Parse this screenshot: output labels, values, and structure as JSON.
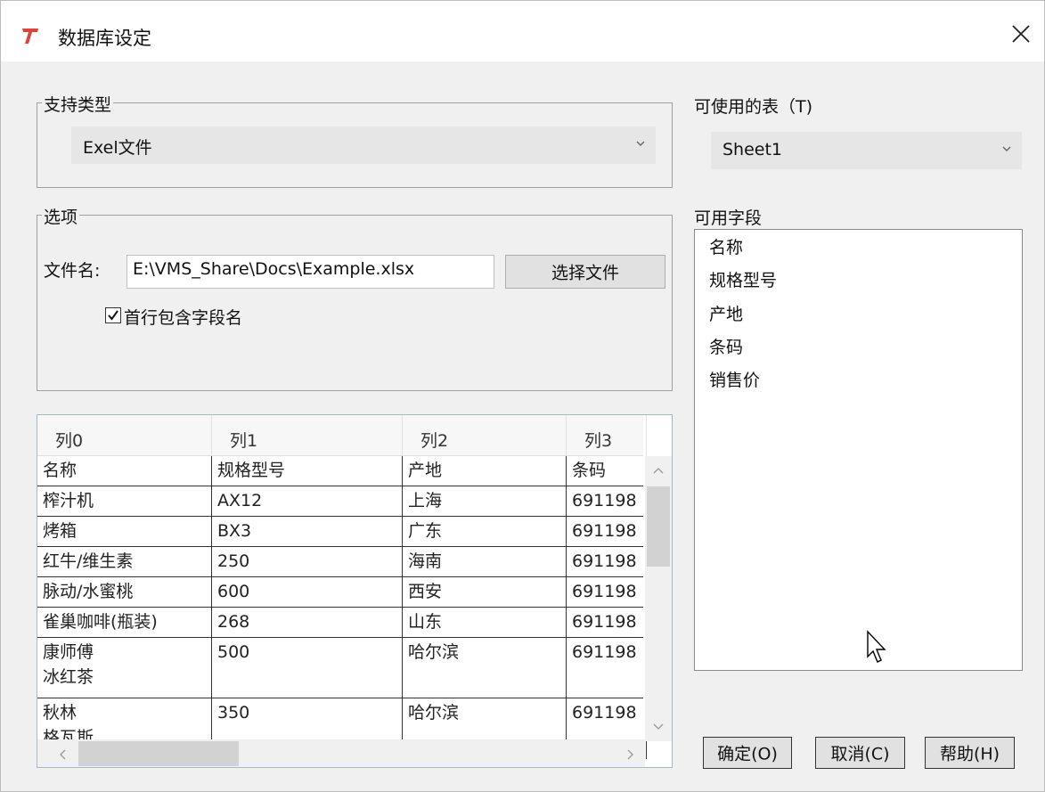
{
  "window": {
    "title": "数据库设定"
  },
  "support_type": {
    "group_label": "支持类型",
    "selected": "Exel文件"
  },
  "options": {
    "group_label": "选项",
    "filename_label": "文件名:",
    "filename_value": "E:\\VMS_Share\\Docs\\Example.xlsx",
    "choose_file_label": "选择文件",
    "header_checkbox_label": "首行包含字段名",
    "header_checkbox_checked": true
  },
  "tables": {
    "label": "可使用的表（T)",
    "selected": "Sheet1"
  },
  "fields": {
    "label": "可用字段",
    "items": [
      "名称",
      "规格型号",
      "产地",
      "条码",
      "销售价"
    ]
  },
  "grid": {
    "columns": [
      "列0",
      "列1",
      "列2",
      "列3"
    ],
    "rows": [
      [
        "名称",
        "规格型号",
        "产地",
        "条码"
      ],
      [
        "榨汁机",
        "AX12",
        "上海",
        "691198"
      ],
      [
        "烤箱",
        "BX3",
        "广东",
        "691198"
      ],
      [
        "红牛/维生素",
        "250",
        "海南",
        "691198"
      ],
      [
        "脉动/水蜜桃",
        "600",
        "西安",
        "691198"
      ],
      [
        "雀巢咖啡(瓶装)",
        "268",
        "山东",
        "691198"
      ],
      [
        "康师傅\n冰红茶",
        "500",
        "哈尔滨",
        "691198"
      ],
      [
        "秋林\n格瓦斯",
        "350",
        "哈尔滨",
        "691198"
      ]
    ]
  },
  "buttons": {
    "ok": "确定(O)",
    "cancel": "取消(C)",
    "help": "帮助(H)"
  }
}
